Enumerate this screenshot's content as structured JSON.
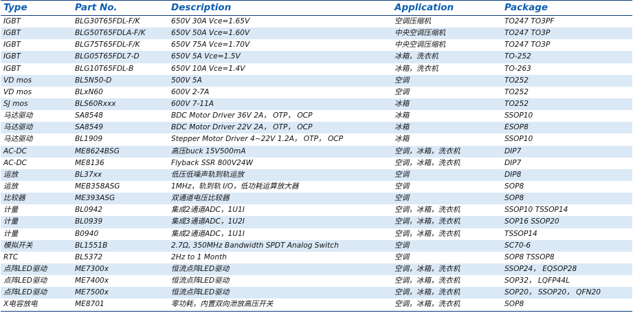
{
  "headers": [
    "Type",
    "Part No.",
    "Description",
    "Application",
    "Package"
  ],
  "rows": [
    [
      "IGBT",
      "BLG30T65FDL-F/K",
      "650V 30A  Vce=1.65V",
      "空调压缩机",
      "TO247 TO3PF"
    ],
    [
      "IGBT",
      "BLG50T65FDLA-F/K",
      "650V 50A  Vce=1.60V",
      "中央空调压缩机",
      "TO247 TO3P"
    ],
    [
      "IGBT",
      "BLG75T65FDL-F/K",
      "650V 75A  Vce=1.70V",
      "中央空调压缩机",
      "TO247 TO3P"
    ],
    [
      "IGBT",
      "BLG05T65FDL7-D",
      "650V 5A  Vce=1.5V",
      "冰箱，洗衣机",
      "TO-252"
    ],
    [
      "IGBT",
      "BLG10T65FDL-B",
      "650V 10A  Vce=1.4V",
      "冰箱，洗衣机",
      "TO-263"
    ],
    [
      "VD mos",
      "BL5N50-D",
      "500V 5A",
      "空调",
      "TO252"
    ],
    [
      "VD mos",
      "BLxN60",
      "600V 2-7A",
      "空调",
      "TO252"
    ],
    [
      "SJ mos",
      "BLS60Rxxx",
      "600V 7-11A",
      "冰箱",
      "TO252"
    ],
    [
      "马达驱动",
      "SA8548",
      "BDC Motor Driver 36V 2A， OTP， OCP",
      "冰箱",
      "SSOP10"
    ],
    [
      "马达驱动",
      "SA8549",
      "BDC Motor Driver 22V 2A， OTP， OCP",
      "冰箱",
      "ESOP8"
    ],
    [
      "马达驱动",
      "BL1909",
      "Stepper Motor Driver  4~22V 1.2A， OTP， OCP",
      "冰箱",
      "SSOP10"
    ],
    [
      "AC-DC",
      "ME8624BSG",
      "高压buck 15V500mA",
      "空调，冰箱，洗衣机",
      "DIP7"
    ],
    [
      "AC-DC",
      "ME8136",
      "Flyback  SSR 800V24W",
      "空调，冰箱，洗衣机",
      "DIP7"
    ],
    [
      "运放",
      "BL37xx",
      "低压低噪声轨到轨运放",
      "空调",
      "DIP8"
    ],
    [
      "运放",
      "MEB358ASG",
      "1MHz，轨到轨 I/O，低功耗运算放大器",
      "空调",
      "SOP8"
    ],
    [
      "比较器",
      "ME393ASG",
      "双通道电压比较器",
      "空调",
      "SOP8"
    ],
    [
      "计量",
      "BL0942",
      "集成2通道ADC，1U1I",
      "空调，冰箱，洗衣机",
      "SSOP10 TSSOP14"
    ],
    [
      "计量",
      "BL0939",
      "集成3通道ADC，1U2I",
      "空调，冰箱，洗衣机",
      "SOP16  SSOP20"
    ],
    [
      "计量",
      "B0940",
      "集成2通道ADC，1U1I",
      "空调，冰箱，洗衣机",
      "TSSOP14"
    ],
    [
      "模拟开关",
      "BL1551B",
      "2.7Ω, 350MHz Bandwidth SPDT Analog Switch",
      "空调",
      "SC70-6"
    ],
    [
      "RTC",
      "BL5372",
      "2Hz to 1 Month",
      "空调",
      "SOP8 TSSOP8"
    ],
    [
      "点阵LED驱动",
      "ME7300x",
      "恒流点阵LED驱动",
      "空调，冰箱，洗衣机",
      "SSOP24， EQSOP28"
    ],
    [
      "点阵LED驱动",
      "ME7400x",
      "恒流点阵LED驱动",
      "空调，冰箱，洗衣机",
      "SOP32， LQFP44L"
    ],
    [
      "点阵LED驱动",
      "ME7500x",
      "恒流点阵LED驱动",
      "空调，冰箱，洗衣机",
      "SOP20， SSOP20， QFN20"
    ],
    [
      "X电容放电",
      "ME8701",
      "零功耗，内置双向泄放高压开关",
      "空调，冰箱，洗衣机",
      "SOP8"
    ]
  ]
}
